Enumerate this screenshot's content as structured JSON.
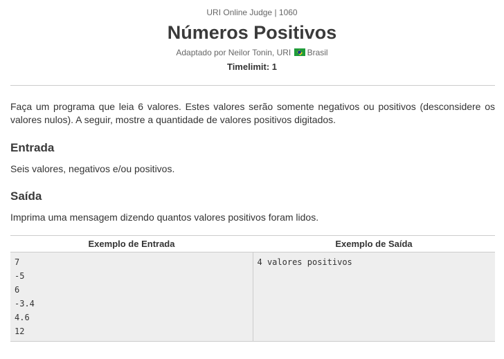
{
  "header": {
    "judge_line": "URI Online Judge | 1060",
    "title": "Números Positivos",
    "author_prefix": "Adaptado por Neilor Tonin, URI",
    "country": "Brasil",
    "country_flag_icon": "brazil-flag-icon",
    "timelimit": "Timelimit: 1"
  },
  "description": "Faça um programa que leia 6 valores. Estes valores serão somente negativos ou positivos (desconsidere os valores nulos). A seguir, mostre a quantidade de valores positivos digitados.",
  "input_section": {
    "heading": "Entrada",
    "text": "Seis valores, negativos e/ou positivos."
  },
  "output_section": {
    "heading": "Saída",
    "text": "Imprima uma mensagem dizendo quantos valores positivos foram lidos."
  },
  "samples": {
    "input_header": "Exemplo de Entrada",
    "output_header": "Exemplo de Saída",
    "input_lines": [
      "7",
      "-5",
      "6",
      "-3.4",
      "4.6",
      "12"
    ],
    "output_lines": [
      "4 valores positivos"
    ]
  },
  "colors": {
    "text": "#333333",
    "divider": "#cccccc",
    "sample_background": "#eeeeee",
    "flag_green": "#1f9b3a",
    "flag_yellow": "#f2d419",
    "flag_blue": "#1b3e8c"
  }
}
